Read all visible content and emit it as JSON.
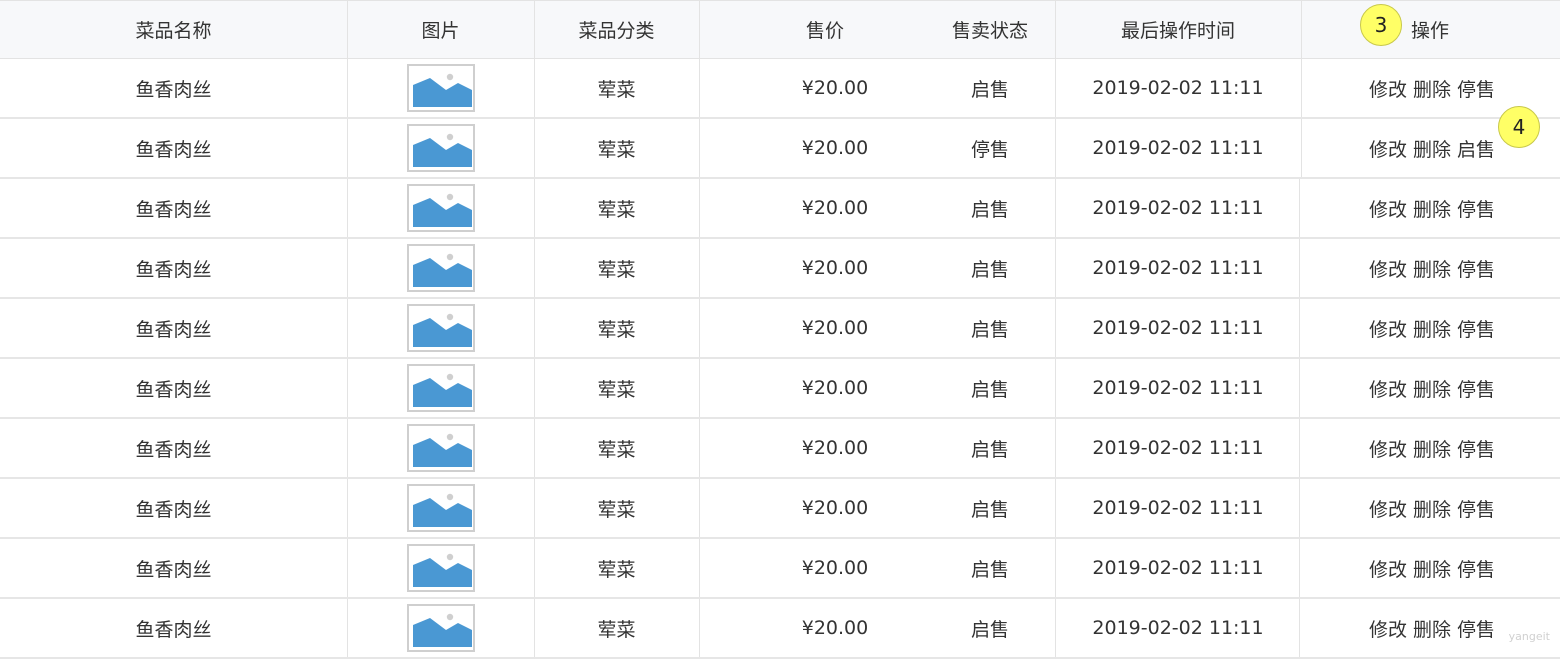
{
  "columns": {
    "name": "菜品名称",
    "image": "图片",
    "category": "菜品分类",
    "price": "售价",
    "status": "售卖状态",
    "updated": "最后操作时间",
    "actions": "操作"
  },
  "rows": [
    {
      "name": "鱼香肉丝",
      "category": "荤菜",
      "price": "¥20.00",
      "status": "启售",
      "updated": "2019-02-02 11:11",
      "edit": "修改",
      "delete": "删除",
      "toggle": "停售"
    },
    {
      "name": "鱼香肉丝",
      "category": "荤菜",
      "price": "¥20.00",
      "status": "停售",
      "updated": "2019-02-02 11:11",
      "edit": "修改",
      "delete": "删除",
      "toggle": "启售"
    },
    {
      "name": "鱼香肉丝",
      "category": "荤菜",
      "price": "¥20.00",
      "status": "启售",
      "updated": "2019-02-02 11:11",
      "edit": "修改",
      "delete": "删除",
      "toggle": "停售"
    },
    {
      "name": "鱼香肉丝",
      "category": "荤菜",
      "price": "¥20.00",
      "status": "启售",
      "updated": "2019-02-02 11:11",
      "edit": "修改",
      "delete": "删除",
      "toggle": "停售"
    },
    {
      "name": "鱼香肉丝",
      "category": "荤菜",
      "price": "¥20.00",
      "status": "启售",
      "updated": "2019-02-02 11:11",
      "edit": "修改",
      "delete": "删除",
      "toggle": "停售"
    },
    {
      "name": "鱼香肉丝",
      "category": "荤菜",
      "price": "¥20.00",
      "status": "启售",
      "updated": "2019-02-02 11:11",
      "edit": "修改",
      "delete": "删除",
      "toggle": "停售"
    },
    {
      "name": "鱼香肉丝",
      "category": "荤菜",
      "price": "¥20.00",
      "status": "启售",
      "updated": "2019-02-02 11:11",
      "edit": "修改",
      "delete": "删除",
      "toggle": "停售"
    },
    {
      "name": "鱼香肉丝",
      "category": "荤菜",
      "price": "¥20.00",
      "status": "启售",
      "updated": "2019-02-02 11:11",
      "edit": "修改",
      "delete": "删除",
      "toggle": "停售"
    },
    {
      "name": "鱼香肉丝",
      "category": "荤菜",
      "price": "¥20.00",
      "status": "启售",
      "updated": "2019-02-02 11:11",
      "edit": "修改",
      "delete": "删除",
      "toggle": "停售"
    },
    {
      "name": "鱼香肉丝",
      "category": "荤菜",
      "price": "¥20.00",
      "status": "启售",
      "updated": "2019-02-02 11:11",
      "edit": "修改",
      "delete": "删除",
      "toggle": "停售"
    }
  ],
  "markers": [
    "3",
    "4"
  ],
  "watermark": "yangeit",
  "colors": {
    "header_bg": "#f7f8fa",
    "border": "#e3e3e3",
    "image_placeholder": "#4a98d3",
    "marker": "#ffff66"
  },
  "icons": {
    "thumbnail": "image-placeholder-icon"
  }
}
